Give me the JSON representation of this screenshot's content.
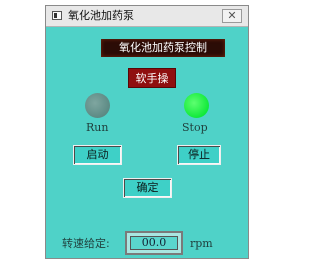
{
  "window": {
    "title": "氧化池加药泵",
    "close_label": "✕"
  },
  "panel": {
    "banner": "氧化池加药泵控制",
    "manual_button": "软手操",
    "run_label": "Run",
    "stop_label": "Stop",
    "start_button": "启动",
    "stop_button": "停止",
    "confirm_button": "确定",
    "speed_label": "转速给定:",
    "speed_value": "00.0",
    "speed_unit": "rpm"
  },
  "colors": {
    "panel_bg": "#4fd2c8",
    "run_lamp": "#6f9a95",
    "stop_lamp": "#11e93a",
    "banner_bg": "#2b0c06",
    "manual_bg": "#8f0f0f"
  },
  "icons": {
    "app": "window-app-icon",
    "close": "close-icon"
  }
}
